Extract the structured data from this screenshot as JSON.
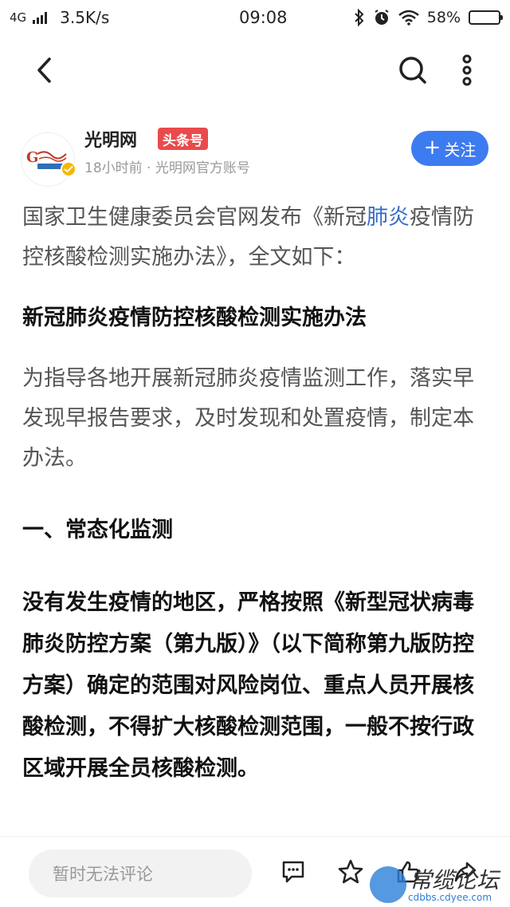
{
  "status_bar": {
    "network": "4G",
    "speed": "3.5K/s",
    "time": "09:08",
    "battery": "58%",
    "battery_level": 0.58
  },
  "author": {
    "name": "光明网",
    "badge": "头条号",
    "meta": "18小时前 · 光明网官方账号",
    "follow_label": "关注",
    "follow_color": "#3d7bf0"
  },
  "article": {
    "intro_before": "国家卫生健康委员会官网发布《新冠",
    "intro_link": "肺炎",
    "intro_after": "疫情防控核酸检测实施办法》，全文如下：",
    "heading": "新冠肺炎疫情防控核酸检测实施办法",
    "paragraph1": "为指导各地开展新冠肺炎疫情监测工作，落实早发现早报告要求，及时发现和处置疫情，制定本办法。",
    "section1": "一、常态化监测",
    "paragraph2": "没有发生疫情的地区，严格按照《新型冠状病毒肺炎防控方案（第九版）》（以下简称第九版防控方案）确定的范围对风险岗位、重点人员开展核酸检测，不得扩大核酸检测范围，一般不按行政区域开展全员核酸检测。",
    "link_color": "#3a6fc4"
  },
  "bottom_bar": {
    "comment_placeholder": "暂时无法评论"
  },
  "watermark": {
    "text": "常缆论坛",
    "url": "cdbbs.cdyee.com"
  }
}
